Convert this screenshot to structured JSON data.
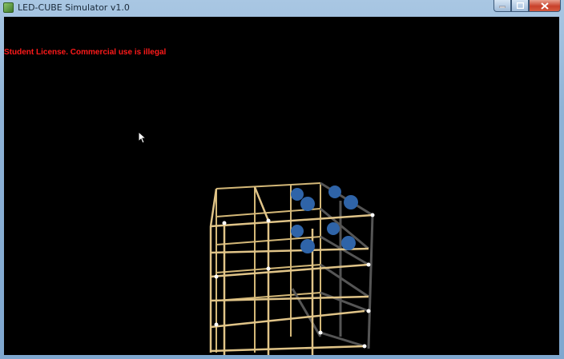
{
  "window": {
    "title": "LED-CUBE Simulator v1.0",
    "icon": "app-icon",
    "controls": [
      "minimize-icon",
      "maximize-icon",
      "close-icon"
    ]
  },
  "viewport": {
    "license_notice": "Student License. Commercial use is illegal",
    "license_color": "#ff1a1a",
    "background": "#000000"
  },
  "cube": {
    "grid_color": "#d4b878",
    "led_on_color": "#2f64a8",
    "led_off_color": "#ffffff"
  }
}
